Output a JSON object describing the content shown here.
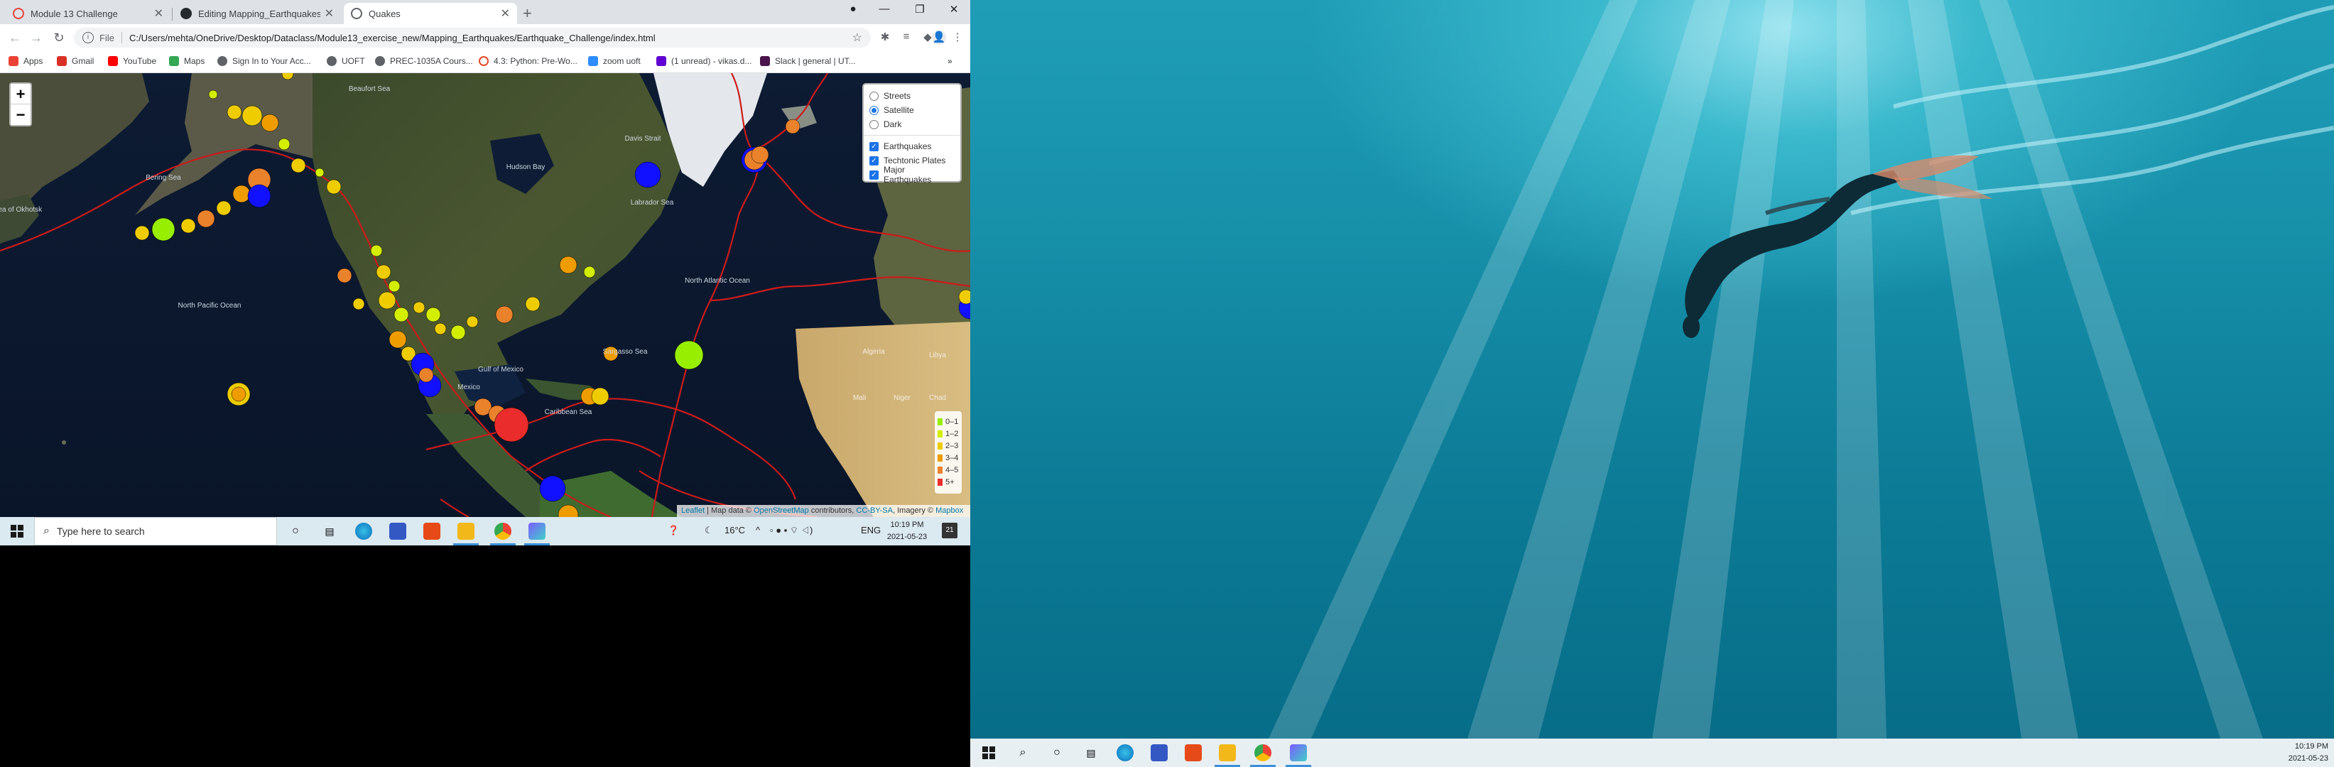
{
  "browser": {
    "tabs": [
      {
        "title": "Module 13 Challenge",
        "color": "#e8453c"
      },
      {
        "title": "Editing Mapping_Earthquakes/R",
        "color": "#24292e"
      },
      {
        "title": "Quakes",
        "color": "#5f6368"
      }
    ],
    "address": {
      "scheme": "File",
      "url": "C:/Users/mehta/OneDrive/Desktop/Dataclass/Module13_exercise_new/Mapping_Earthquakes/Earthquake_Challenge/index.html"
    },
    "bookmarks": [
      {
        "label": "Apps",
        "color": "#ea4335"
      },
      {
        "label": "Gmail",
        "color": "#d93025"
      },
      {
        "label": "YouTube",
        "color": "#ff0000"
      },
      {
        "label": "Maps",
        "color": "#34a853"
      },
      {
        "label": "Sign In to Your Acc...",
        "color": "#5f6368"
      },
      {
        "label": "UOFT",
        "color": "#5f6368"
      },
      {
        "label": "PREC-1035A Cours...",
        "color": "#5f6368"
      },
      {
        "label": "4.3: Python: Pre-Wo...",
        "color": "#e34c26"
      },
      {
        "label": "zoom uoft",
        "color": "#2d8cff"
      },
      {
        "label": "(1 unread) - vikas.d...",
        "color": "#6001d2"
      },
      {
        "label": "Slack | general | UT...",
        "color": "#4a154b"
      }
    ]
  },
  "map": {
    "zoom_in": "+",
    "zoom_out": "−",
    "base_layers": [
      {
        "label": "Streets",
        "selected": false
      },
      {
        "label": "Satellite",
        "selected": true
      },
      {
        "label": "Dark",
        "selected": false
      }
    ],
    "overlays": [
      {
        "label": "Earthquakes",
        "checked": true
      },
      {
        "label": "Techtonic Plates",
        "checked": true
      },
      {
        "label": "Major Earthquakes",
        "checked": true
      }
    ],
    "legend": [
      {
        "label": "0–1",
        "color": "#98ee00"
      },
      {
        "label": "1–2",
        "color": "#d4ee00"
      },
      {
        "label": "2–3",
        "color": "#eecc00"
      },
      {
        "label": "3–4",
        "color": "#ee9c00"
      },
      {
        "label": "4–5",
        "color": "#ea822c"
      },
      {
        "label": "5+",
        "color": "#ea2c2c"
      }
    ],
    "place_labels": {
      "bering_sea": "Bering Sea",
      "sea_of_okhotsk": "Sea of Okhotsk",
      "north_pacific": "North Pacific Ocean",
      "hudson_bay": "Hudson Bay",
      "north_atlantic": "North Atlantic Ocean",
      "sargasso_sea": "Sargasso Sea",
      "caribbean_sea": "Caribbean Sea",
      "gulf_of_mexico": "Gulf of Mexico",
      "labrador_sea": "Labrador Sea",
      "davis_strait": "Davis Strait",
      "beaufort_sea": "Beaufort Sea",
      "algeria": "Algeria",
      "libya": "Libya",
      "mali": "Mali",
      "niger": "Niger",
      "chad": "Chad",
      "mexico": "Mexico"
    },
    "attribution": {
      "leaflet": "Leaflet",
      "map_data": "Map data ©",
      "osm": "OpenStreetMap",
      "contributors": "contributors,",
      "cc": "CC-BY-SA",
      "imagery": ", Imagery ©",
      "mapbox": "Mapbox"
    }
  },
  "taskbar_left": {
    "search_placeholder": "Type here to search",
    "weather": "16°C",
    "language": "ENG",
    "time": "10:19 PM",
    "date": "2021-05-23",
    "notification_count": "21"
  },
  "taskbar_right": {
    "time": "10:19 PM",
    "date": "2021-05-23"
  }
}
